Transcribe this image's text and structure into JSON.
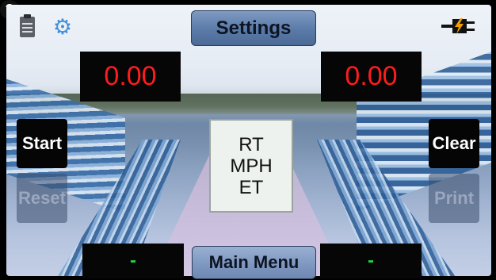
{
  "header": {
    "settings_label": "Settings"
  },
  "icons": {
    "log": "clipboard-icon",
    "settings": "gear-icon",
    "help": "help-icon",
    "help_glyph": "?",
    "power": "plug-icon"
  },
  "displays": {
    "left_top": "0.00",
    "right_top": "0.00",
    "left_bottom": "-",
    "right_bottom": "-"
  },
  "buttons": {
    "start": "Start",
    "reset": "Reset",
    "clear": "Clear",
    "print": "Print",
    "main_menu": "Main Menu"
  },
  "center_label": {
    "line1": "RT",
    "line2": "MPH",
    "line3": "ET"
  },
  "colors": {
    "timer_red": "#ff1c1c",
    "status_green": "#1fd43a",
    "button_blue": "#5a7aa8",
    "gear_blue": "#3f8ed8",
    "plug_orange": "#f0a000"
  }
}
